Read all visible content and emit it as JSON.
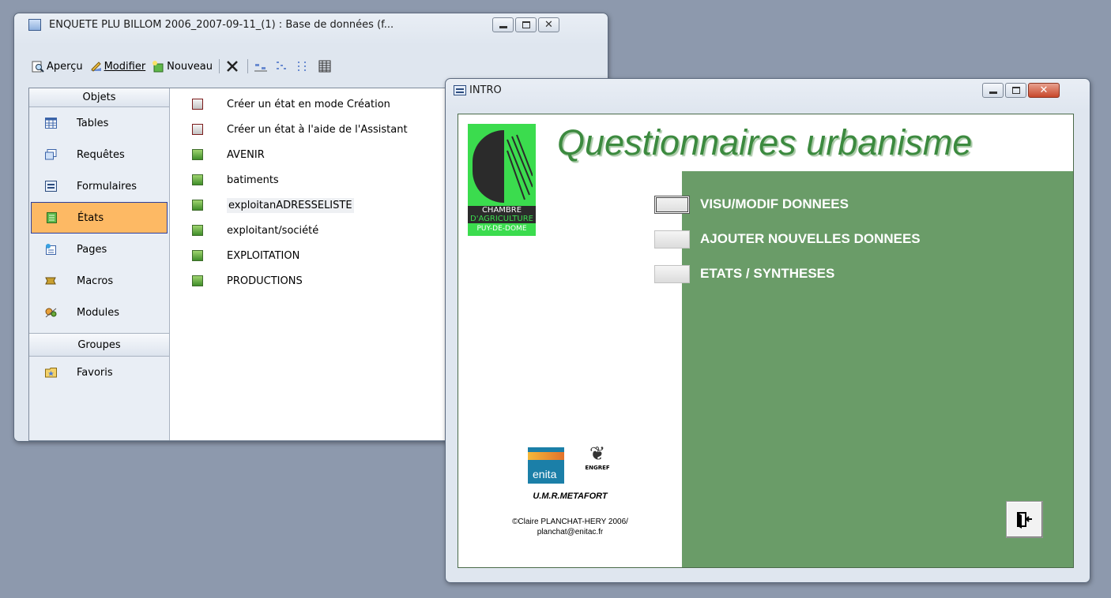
{
  "db_window": {
    "title": "ENQUETE PLU BILLOM 2006_2007-09-11_(1) : Base de données (f...",
    "toolbar": {
      "apercu": "Aperçu",
      "modifier": "Modifier",
      "nouveau": "Nouveau"
    },
    "objects_header": "Objets",
    "objects": [
      {
        "label": "Tables",
        "icon": "table-icon"
      },
      {
        "label": "Requêtes",
        "icon": "query-icon"
      },
      {
        "label": "Formulaires",
        "icon": "form-icon"
      },
      {
        "label": "États",
        "icon": "report-icon"
      },
      {
        "label": "Pages",
        "icon": "page-icon"
      },
      {
        "label": "Macros",
        "icon": "macro-icon"
      },
      {
        "label": "Modules",
        "icon": "module-icon"
      }
    ],
    "groups_header": "Groupes",
    "groups": [
      {
        "label": "Favoris",
        "icon": "favorites-folder-icon"
      }
    ],
    "items": [
      "Créer un état en mode Création",
      "Créer un état à l'aide de l'Assistant",
      "AVENIR",
      "batiments",
      "exploitanADRESSELISTE",
      "exploitant/société",
      "EXPLOITATION",
      "PRODUCTIONS"
    ]
  },
  "intro_window": {
    "title": "INTRO",
    "heading": "Questionnaires urbanisme",
    "logo": {
      "line1": "CHAMBRE",
      "line2": "D'AGRICULTURE",
      "line3": "PUY-DE-DOME"
    },
    "menu": [
      "VISU/MODIF  DONNEES",
      "AJOUTER NOUVELLES DONNEES",
      "ETATS / SYNTHESES"
    ],
    "partner1": "enita",
    "partner2": "ENGREF",
    "umr": "U.M.R.METAFORT",
    "credit1": "©Claire PLANCHAT-HERY 2006/",
    "credit2": "planchat@enitac.fr"
  },
  "colors": {
    "desktop": "#8d99ad",
    "selected_object": "#fdb964",
    "intro_green": "#6a9c68",
    "title_green": "#3c8a3f"
  }
}
